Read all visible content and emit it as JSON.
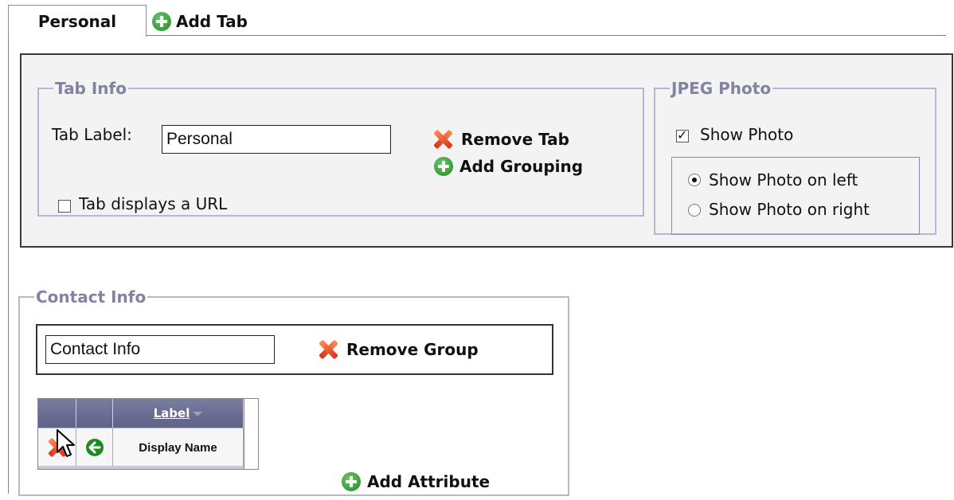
{
  "tabs": {
    "active_label": "Personal",
    "add_tab_label": "Add Tab"
  },
  "tab_info": {
    "legend": "Tab Info",
    "tab_label_caption": "Tab Label:",
    "tab_label_value": "Personal",
    "url_checkbox_label": "Tab displays a URL",
    "url_checkbox_checked": false,
    "remove_tab_label": "Remove Tab",
    "add_grouping_label": "Add Grouping"
  },
  "jpeg_photo": {
    "legend": "JPEG Photo",
    "show_photo_label": "Show Photo",
    "show_photo_checked": true,
    "position_options": [
      "Show Photo on left",
      "Show Photo on right"
    ],
    "selected_position": "Show Photo on left"
  },
  "contact_group": {
    "legend": "Contact Info",
    "name_value": "Contact Info",
    "remove_group_label": "Remove Group",
    "add_attribute_label": "Add Attribute",
    "grid": {
      "column_header": "Label",
      "rows": [
        {
          "label": "Display Name"
        }
      ]
    }
  },
  "colors": {
    "add_icon": "#1f8a23",
    "remove_icon": "#d9331a",
    "fieldset_border": "#b7b7d4",
    "legend_text": "#8282a5",
    "grid_header": "#5e6188"
  },
  "icons": {
    "add": "plus-circle-icon",
    "remove": "red-x-icon",
    "move": "arrow-circle-icon",
    "cursor": "mouse-pointer-icon"
  }
}
